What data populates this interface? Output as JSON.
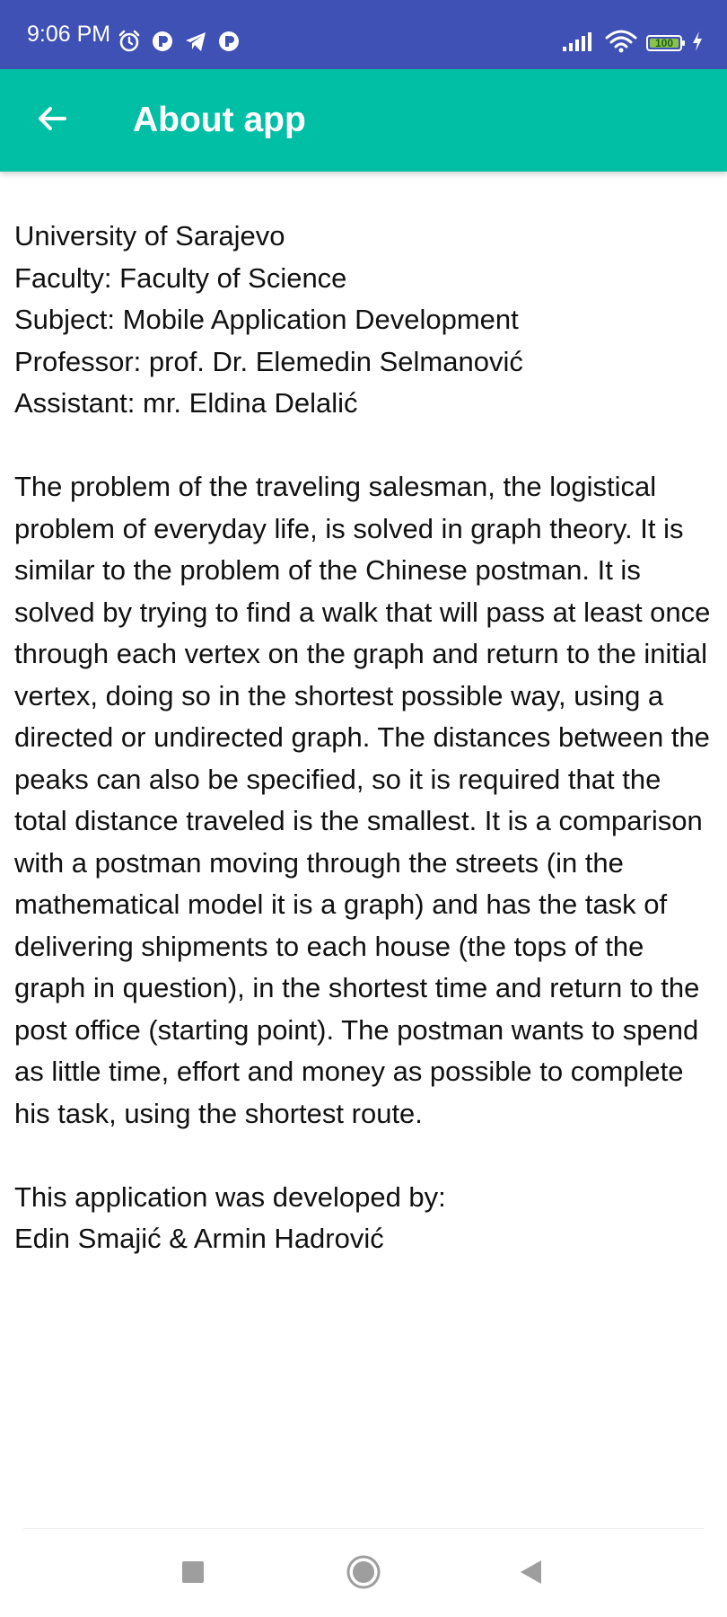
{
  "status_bar": {
    "time": "9:06 PM",
    "battery_level": "100",
    "left_icons": [
      "alarm-icon",
      "notification-app-icon",
      "telegram-icon",
      "notification-app-icon"
    ],
    "right_icons": [
      "signal-icon",
      "wifi-icon",
      "battery-icon",
      "charging-icon"
    ],
    "colors": {
      "background": "#3f51b5",
      "battery_fill": "#8bc34a"
    }
  },
  "app_bar": {
    "title": "About app",
    "back_icon": "arrow-back-icon",
    "colors": {
      "background": "#00bfa5",
      "text": "#ffffff"
    }
  },
  "content": {
    "info": [
      "University of Sarajevo",
      "Faculty: Faculty of Science",
      "Subject: Mobile Application Development",
      "Professor: prof. Dr. Elemedin Selmanović",
      "Assistant: mr. Eldina Delalić"
    ],
    "description": "The problem of the traveling salesman, the logistical problem of everyday life, is solved in graph theory. It is similar to the problem of the Chinese postman. It is solved by trying to find a walk that will pass at least once through each vertex on the graph and return to the initial vertex, doing so in the shortest possible way, using a directed or undirected graph. The distances between the peaks can also be specified, so it is required that the total distance traveled is the smallest. It is a comparison with a postman moving through the streets (in the mathematical model it is a graph) and has the task of delivering shipments to each house (the tops of the graph in question), in the shortest time and return to the post office (starting point). The postman wants to spend as little time, effort and money as possible to complete his task, using the shortest route.",
    "developed_by_label": "This application was developed by:",
    "developers": "Edin Smajić & Armin Hadrović"
  },
  "nav_bar": {
    "buttons": [
      "recents-icon",
      "home-icon",
      "back-icon"
    ]
  }
}
